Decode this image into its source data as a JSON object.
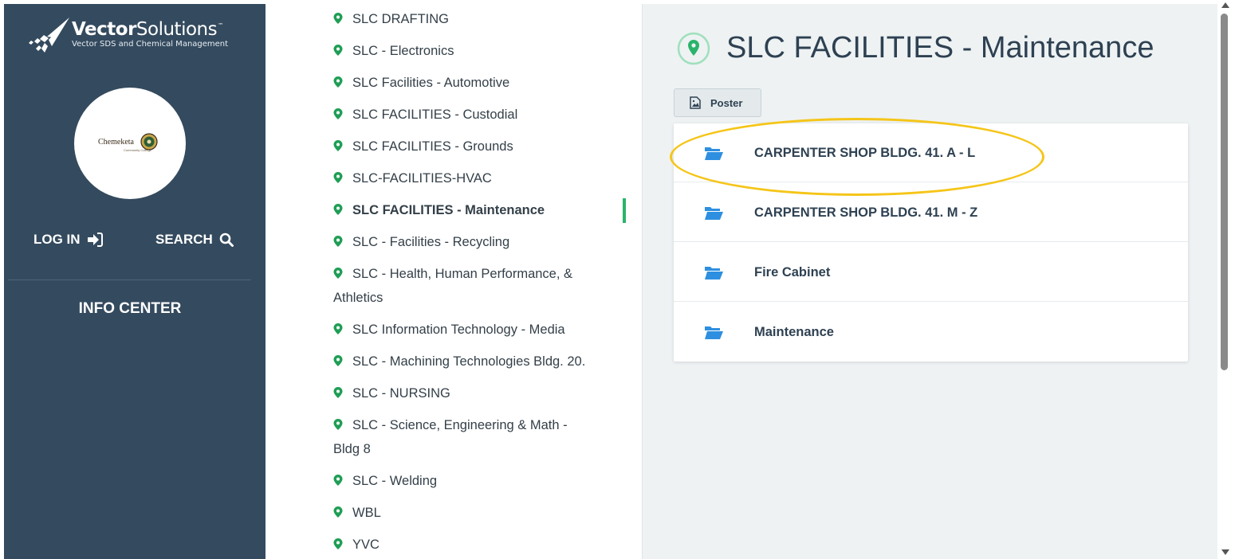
{
  "brand": {
    "name_bold": "Vector",
    "name_light": "Solutions",
    "tm": "™",
    "subtitle": "Vector SDS and Chemical Management"
  },
  "org": {
    "name": "Chemeketa",
    "subtitle": "Community College"
  },
  "sidebar": {
    "login_label": "LOG IN",
    "search_label": "SEARCH",
    "info_center_label": "INFO CENTER"
  },
  "locations": [
    {
      "label": "SLC DRAFTING"
    },
    {
      "label": "SLC - Electronics"
    },
    {
      "label": "SLC Facilities - Automotive"
    },
    {
      "label": "SLC FACILITIES - Custodial"
    },
    {
      "label": "SLC FACILITIES - Grounds"
    },
    {
      "label": "SLC-FACILITIES-HVAC"
    },
    {
      "label": "SLC FACILITIES - Maintenance",
      "active": true
    },
    {
      "label": "SLC - Facilities - Recycling"
    },
    {
      "label": "SLC - Health, Human Performance, &",
      "label_line2": "Athletics"
    },
    {
      "label": "SLC Information Technology - Media"
    },
    {
      "label": "SLC - Machining Technologies Bldg. 20."
    },
    {
      "label": "SLC - NURSING"
    },
    {
      "label": "SLC - Science, Engineering & Math -",
      "label_line2": "Bldg 8"
    },
    {
      "label": "SLC - Welding"
    },
    {
      "label": "WBL"
    },
    {
      "label": "YVC"
    }
  ],
  "main": {
    "title": "SLC FACILITIES - Maintenance",
    "poster_label": "Poster",
    "folders": [
      {
        "label": "CARPENTER SHOP BLDG. 41. A - L",
        "highlighted": true
      },
      {
        "label": "CARPENTER SHOP BLDG. 41. M - Z"
      },
      {
        "label": "Fire Cabinet"
      },
      {
        "label": "Maintenance"
      }
    ]
  },
  "colors": {
    "sidebar_bg": "#344a5e",
    "accent_green": "#2bb36b",
    "folder_blue": "#2e8fe0",
    "highlight_yellow": "#f5c518"
  }
}
